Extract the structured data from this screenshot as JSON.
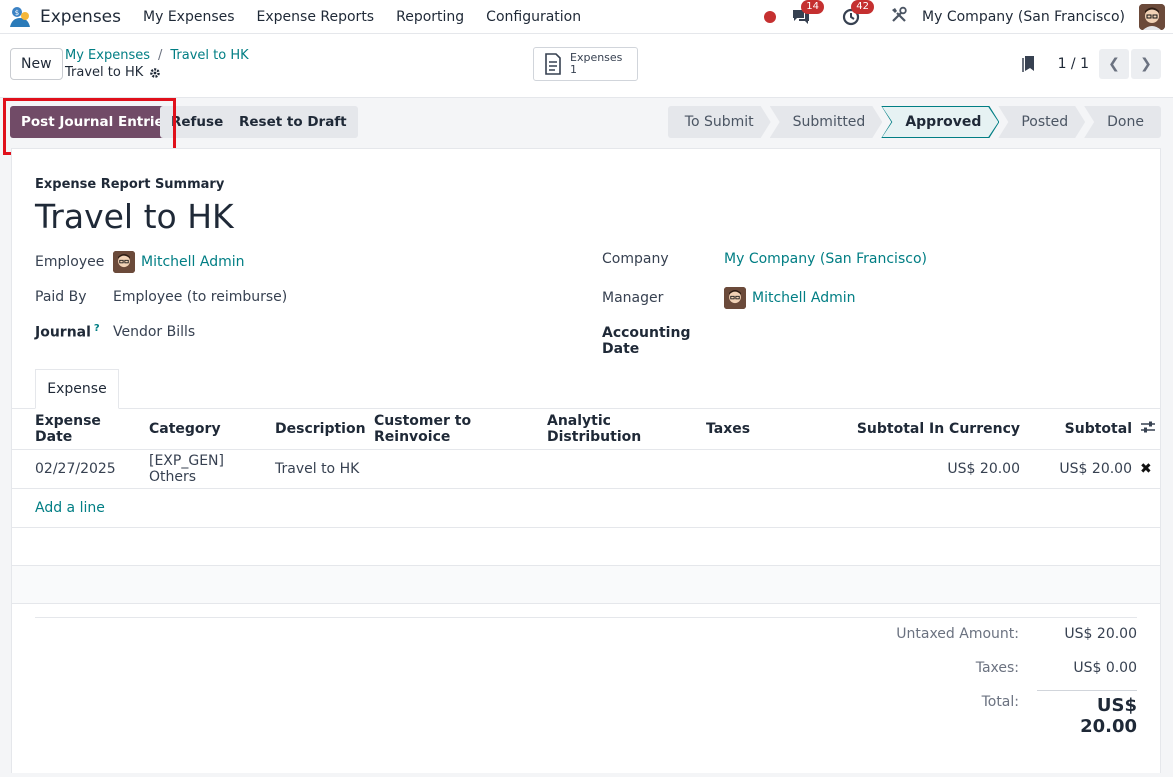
{
  "app": {
    "name": "Expenses"
  },
  "nav": {
    "menu": [
      "My Expenses",
      "Expense Reports",
      "Reporting",
      "Configuration"
    ],
    "messages_count": "14",
    "activities_count": "42",
    "company": "My Company (San Francisco)"
  },
  "control": {
    "new_label": "New",
    "breadcrumb": [
      "My Expenses",
      "Travel to HK"
    ],
    "record_name": "Travel to HK",
    "smart_button": {
      "label": "Expenses",
      "count": "1"
    },
    "pager": "1 / 1"
  },
  "actions": {
    "post": "Post Journal Entries",
    "refuse": "Refuse",
    "reset": "Reset to Draft"
  },
  "stages": [
    "To Submit",
    "Submitted",
    "Approved",
    "Posted",
    "Done"
  ],
  "active_stage": "Approved",
  "form": {
    "subtitle": "Expense Report Summary",
    "title": "Travel to HK",
    "employee_label": "Employee",
    "employee": "Mitchell Admin",
    "paid_by_label": "Paid By",
    "paid_by": "Employee (to reimburse)",
    "journal_label": "Journal",
    "journal_help": "?",
    "journal": "Vendor Bills",
    "company_label": "Company",
    "company": "My Company (San Francisco)",
    "manager_label": "Manager",
    "manager": "Mitchell Admin",
    "accounting_date_label": "Accounting Date",
    "tab": "Expense"
  },
  "lines": {
    "headers": [
      "Expense Date",
      "Category",
      "Description",
      "Customer to Reinvoice",
      "Analytic Distribution",
      "Taxes",
      "Subtotal In Currency",
      "Subtotal"
    ],
    "rows": [
      {
        "date": "02/27/2025",
        "category": "[EXP_GEN] Others",
        "description": "Travel to HK",
        "customer": "",
        "analytic": "",
        "taxes": "",
        "subtotal_currency": "US$ 20.00",
        "subtotal": "US$ 20.00"
      }
    ],
    "add_line": "Add a line"
  },
  "totals": {
    "untaxed_label": "Untaxed Amount:",
    "untaxed": "US$ 20.00",
    "taxes_label": "Taxes:",
    "taxes": "US$ 0.00",
    "total_label": "Total:",
    "total": "US$ 20.00"
  },
  "colors": {
    "primary": "#714b67",
    "link": "#017e84",
    "badge": "#c53030",
    "highlight": "#e0101b"
  }
}
